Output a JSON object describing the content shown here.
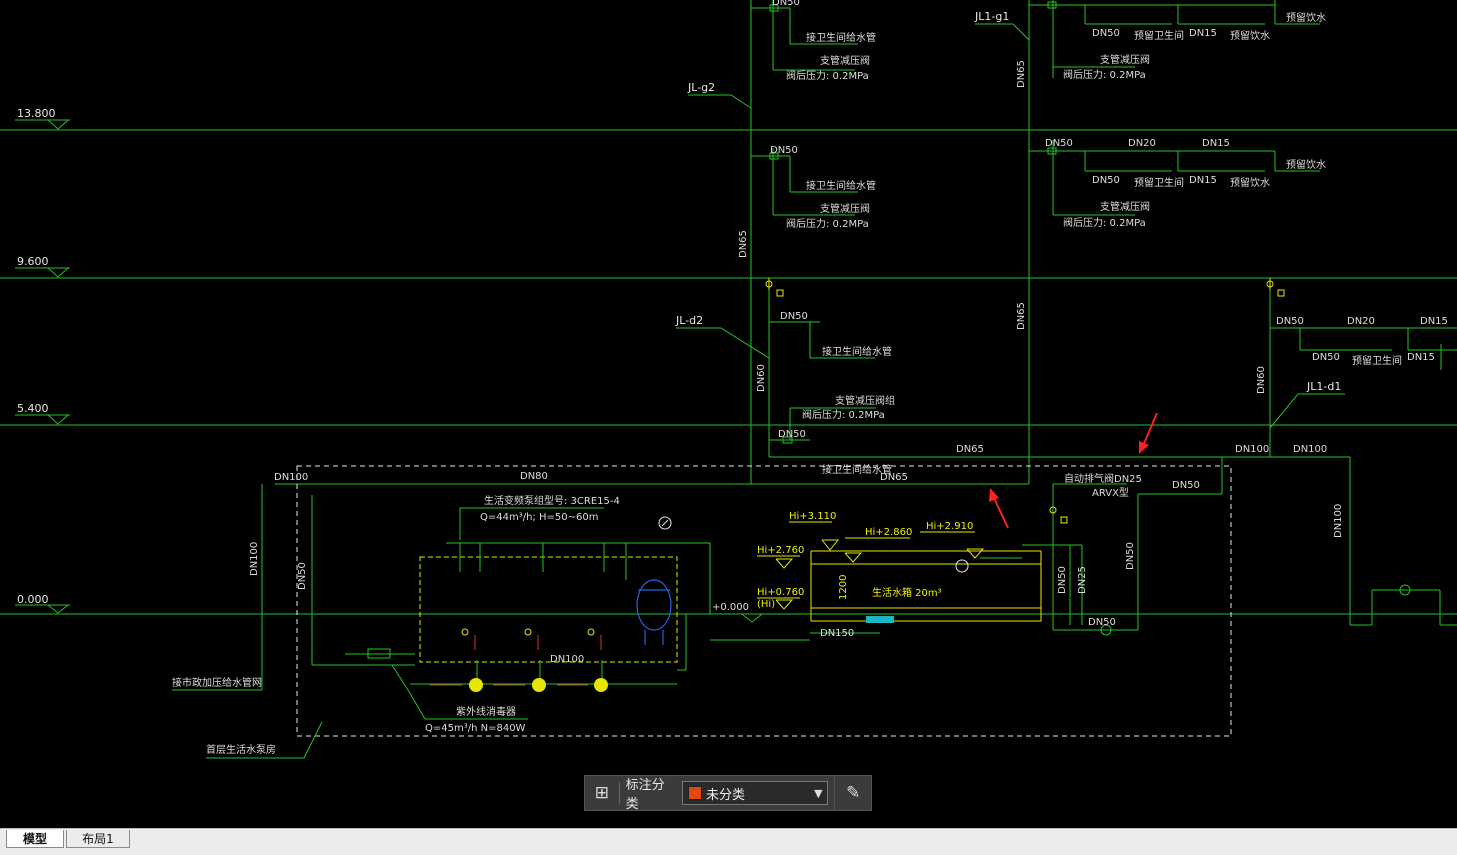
{
  "drawing": {
    "elevations": [
      "13.800",
      "9.600",
      "5.400",
      "0.000"
    ],
    "riser_labels": [
      "JL1-g1",
      "JL-g2",
      "JL-d2",
      "JL1-d1"
    ],
    "pipe_sizes": {
      "dn80": "DN80",
      "dn65": "DN65",
      "dn50": "DN50",
      "dn20": "DN20",
      "dn15": "DN15",
      "dn100": "DN100",
      "dn150": "DN150",
      "dn25": "DN25",
      "dn60": "DN60"
    },
    "notes": {
      "branch_main": "接卫生间给水管",
      "reducing_valve": "支管减压阀",
      "reducing_group": "支管减压阀组",
      "after_pressure": "阀后压力: 0.2MPa",
      "reserved_toilet": "预留卫生间",
      "reserved_drinking": "预留饮水",
      "air_valve": "自动排气阀DN25",
      "arvx": "ARVX型",
      "pump_model": "生活变频泵组型号: 3CRE15-4",
      "pump_spec": "Q=44m³/h; H=50~60m",
      "disinfector": "紫外线消毒器",
      "disinfector_spec": "Q=45m³/h  N=840W",
      "pump_room": "首层生活水泵房",
      "municipal": "接市政加压给水管网",
      "tank": "生活水箱 20m³",
      "tank_height": "1200",
      "floor_level": "+0.000"
    },
    "water_levels": {
      "hi_3110": "Hi+3.110",
      "hi_2860": "Hi+2.860",
      "hi_2910": "Hi+2.910",
      "hi_2760": "Hi+2.760",
      "hi_0760": "Hi+0.760",
      "hi_paren": "(Hi)"
    }
  },
  "toolbar": {
    "category_label": "标注分类",
    "selected_value": "未分类",
    "swatch_color": "#e04a12",
    "grid_icon": "grid-icon",
    "caret_icon": "chevron-down-icon",
    "edit_icon": "edit-icon"
  },
  "layout_tabs": [
    {
      "label": "模型",
      "active": true
    },
    {
      "label": "布局1",
      "active": false
    }
  ]
}
